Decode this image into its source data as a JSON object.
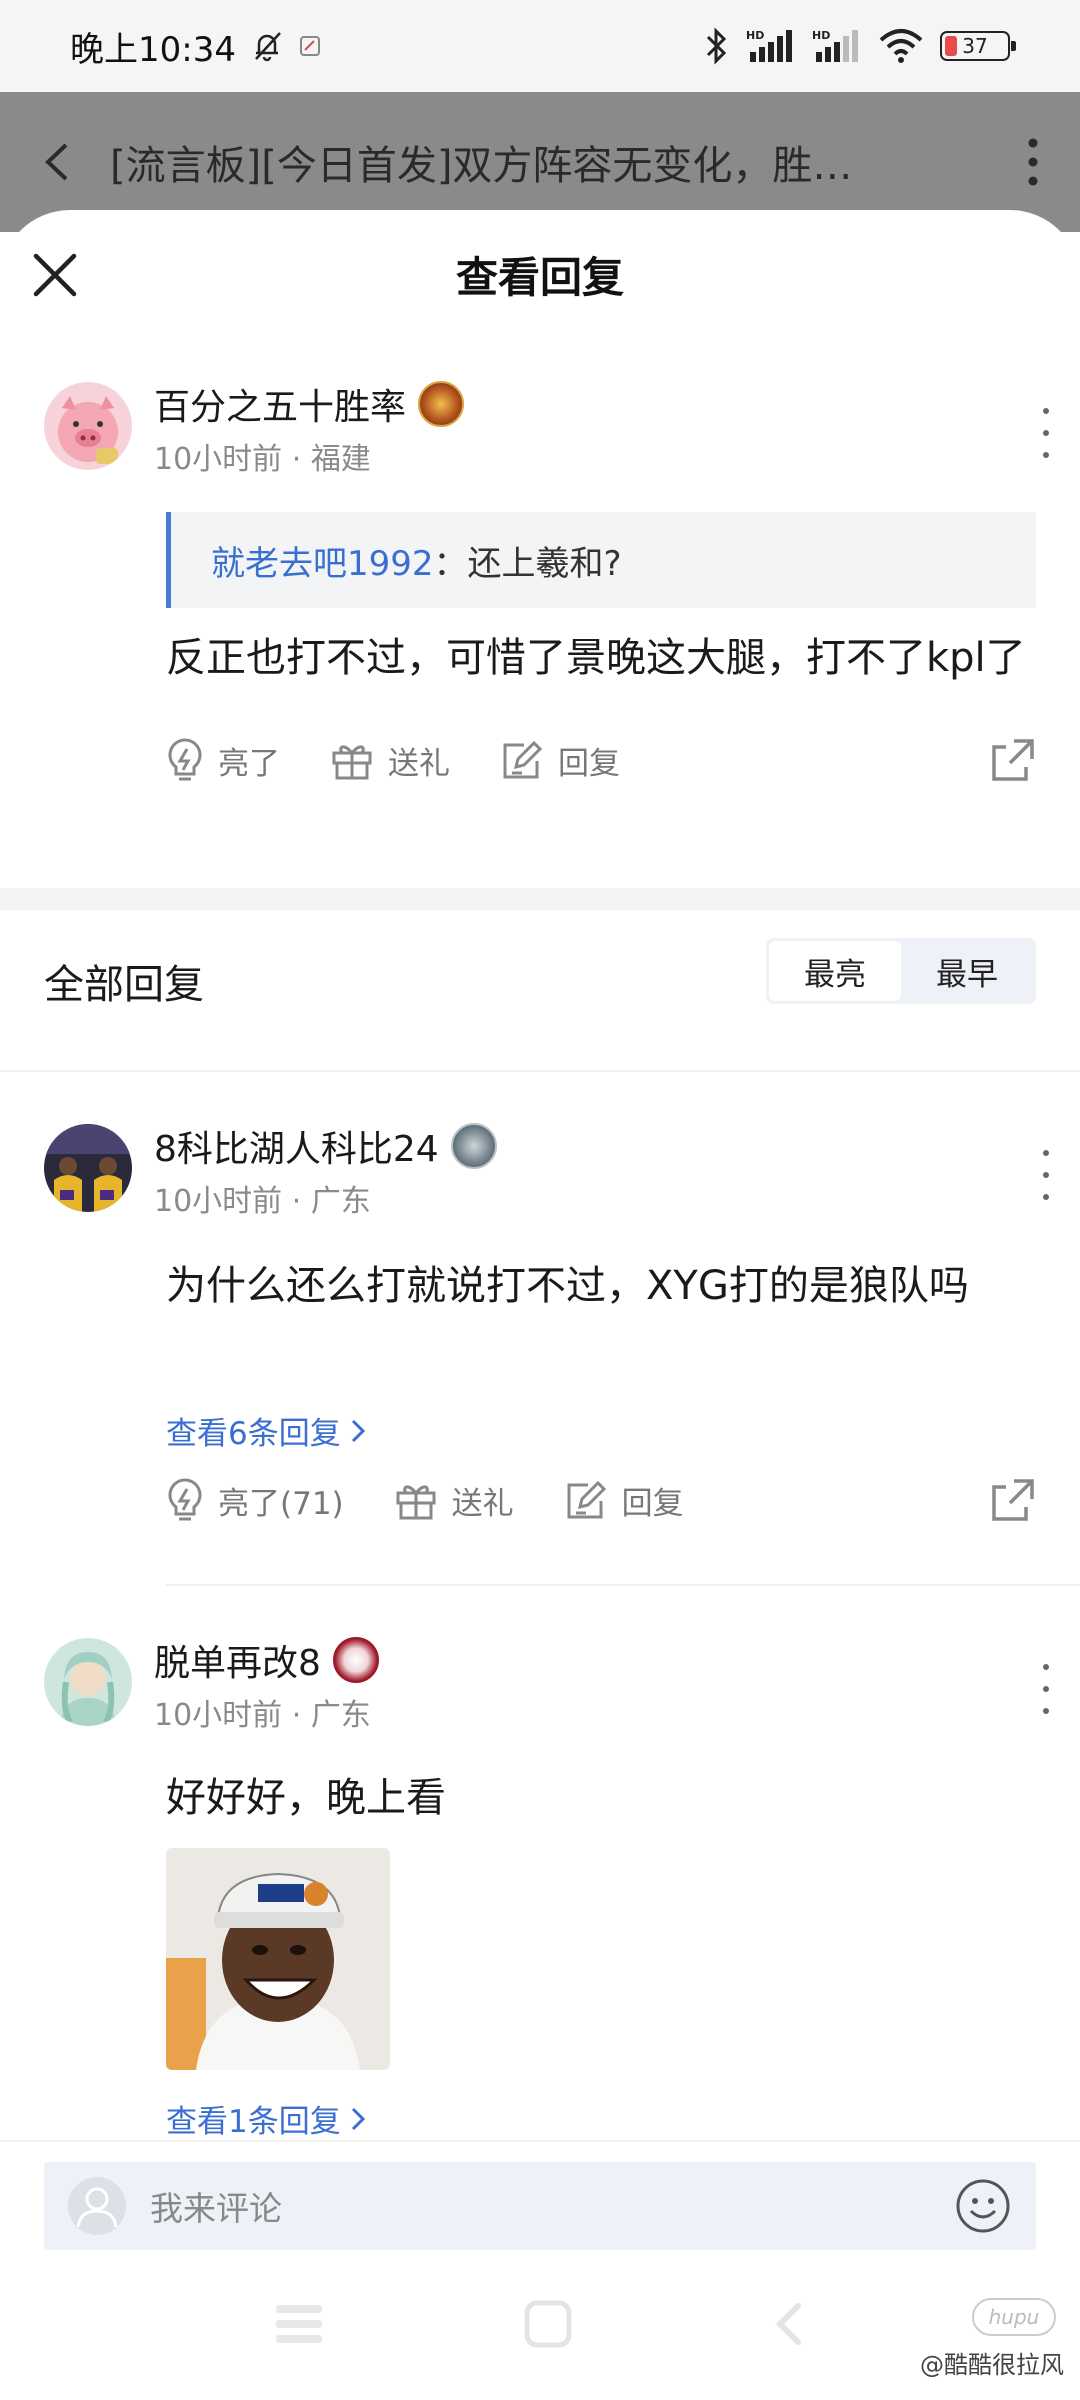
{
  "status_bar": {
    "time": "晚上10:34",
    "battery": "37"
  },
  "page_header": {
    "title": "[流言板][今日首发]双方阵容无变化，胜…"
  },
  "sheet": {
    "title": "查看回复"
  },
  "main_post": {
    "username": "百分之五十胜率",
    "time": "10小时前",
    "location": "福建",
    "quote_user": "就老去吧1992",
    "quote_sep": "：",
    "quote_text": "还上羲和?",
    "content": "反正也打不过，可惜了景晚这大腿，打不了kpl了",
    "actions": {
      "like": "亮了",
      "gift": "送礼",
      "reply": "回复"
    }
  },
  "replies_section": {
    "title": "全部回复",
    "sort_options": [
      "最亮",
      "最早"
    ],
    "selected_sort": "最亮"
  },
  "replies": [
    {
      "username": "8科比湖人科比24",
      "time": "10小时前",
      "location": "广东",
      "content": "为什么还么打就说打不过，XYG打的是狼队吗",
      "view_replies": "查看6条回复",
      "actions": {
        "like": "亮了(71)",
        "gift": "送礼",
        "reply": "回复"
      }
    },
    {
      "username": "脱单再改8",
      "time": "10小时前",
      "location": "广东",
      "content": "好好好，晚上看",
      "view_replies": "查看1条回复"
    }
  ],
  "comment_input": {
    "placeholder": "我来评论"
  },
  "watermark": {
    "logo": "hupu",
    "text": "@酷酷很拉风"
  },
  "colors": {
    "accent": "#3a6fd1",
    "muted_text": "#8a8a8a",
    "section_bg": "#f3f4f6"
  }
}
